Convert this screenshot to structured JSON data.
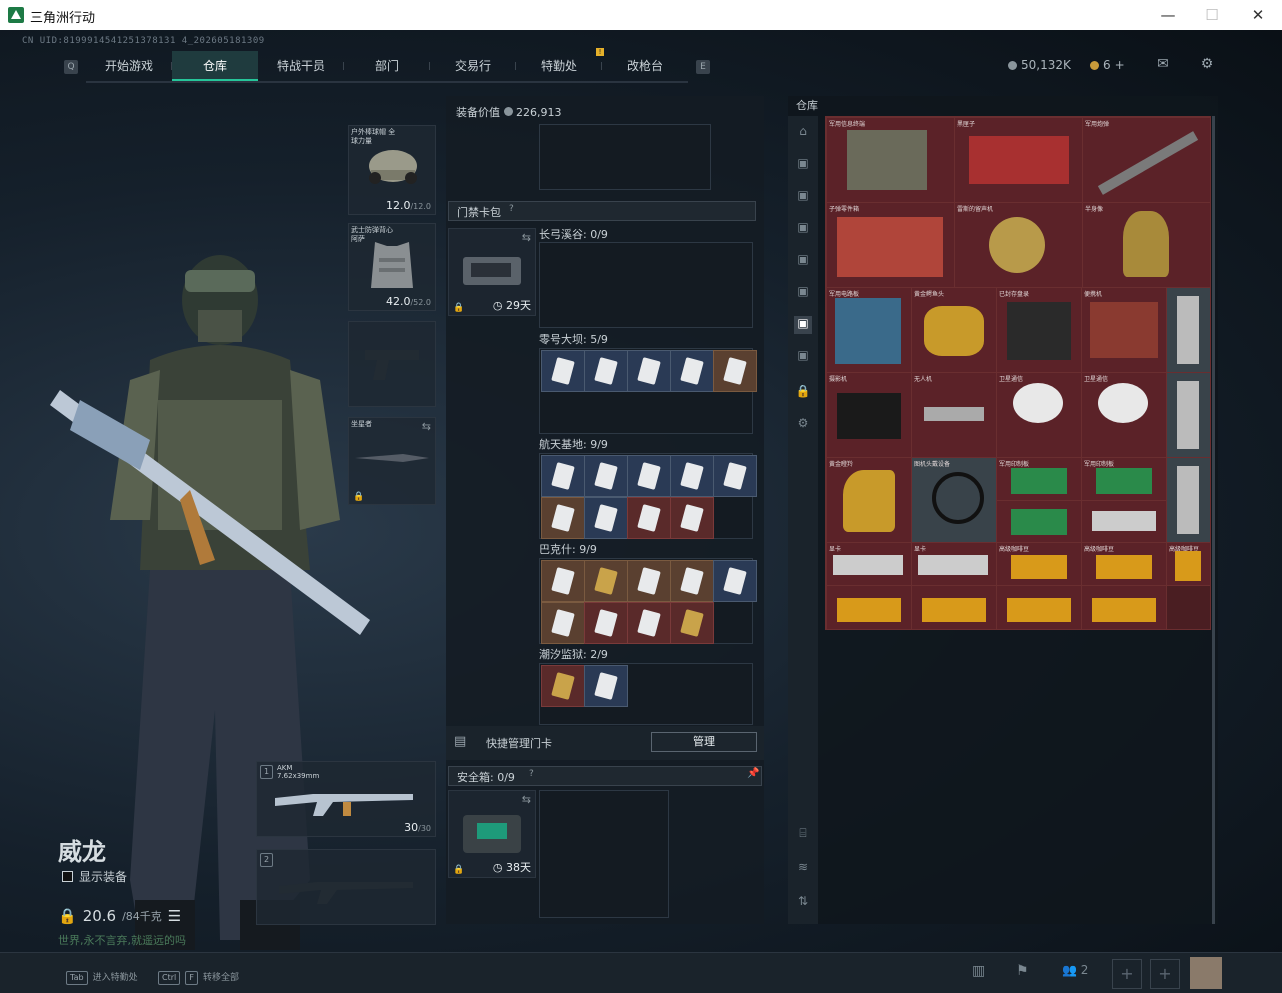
{
  "window": {
    "title": "三角洲行动",
    "minimize": "—",
    "maximize": "☐",
    "close": "✕"
  },
  "uid": "CN UID:8199914541251378131 4_202605181309",
  "nav": {
    "tabs": [
      "开始游戏",
      "仓库",
      "特战干员",
      "部门",
      "交易行",
      "特勤处",
      "改枪台"
    ],
    "active_tab": "仓库",
    "left_key": "Q",
    "right_key": "E",
    "badge": "!"
  },
  "currency": {
    "coins": "50,132K",
    "gold": "6",
    "add": "+"
  },
  "character": {
    "name": "威龙",
    "show_equipment": "显示装备",
    "weight": "20.6",
    "weight_max": "/84千克",
    "motto": "世界,永不言弃,就遥远的吗"
  },
  "slots": {
    "helmet": {
      "name": "户外棒球帽 全球力量",
      "value": "12.0",
      "max": "/12.0"
    },
    "armor": {
      "name": "武士防弹背心 阿萨",
      "value": "42.0",
      "max": "/52.0"
    },
    "melee": {
      "name": "坐星者"
    },
    "weapon1": {
      "index": "1",
      "name": "AKM",
      "caliber": "7.62x39mm",
      "ammo": "30",
      "ammo_max": "/30"
    },
    "weapon2": {
      "index": "2"
    }
  },
  "equipment": {
    "value_label": "装备价值",
    "value": "226,913",
    "keycard_bag": "门禁卡包",
    "help": "?",
    "bag_days": "29天",
    "maps": [
      {
        "name": "长弓溪谷",
        "count": "0/9"
      },
      {
        "name": "零号大坝",
        "count": "5/9"
      },
      {
        "name": "航天基地",
        "count": "9/9"
      },
      {
        "name": "巴克什",
        "count": "9/9"
      },
      {
        "name": "潮汐监狱",
        "count": "2/9"
      }
    ],
    "quick_manage": "快捷管理门卡",
    "manage_button": "管理",
    "safe_box": "安全箱",
    "safe_count": "0/9",
    "safe_days": "38天"
  },
  "warehouse": {
    "title": "仓库",
    "items": [
      "军用信息终端",
      "黑匣子",
      "军用炮弹",
      "子弹零件箱",
      "雷斯的留声机",
      "半身像",
      "军用电路板",
      "黄金鳄鱼头",
      "已封存盘录",
      "便携机",
      "摄影机",
      "无人机",
      "卫星通信",
      "卫星通信",
      "黄金瞪羚",
      "图机头戴设备",
      "军用印制板",
      "军用印制板",
      "显卡",
      "显卡",
      "高级咖啡豆",
      "高级咖啡豆",
      "高级咖啡豆"
    ]
  },
  "footer": {
    "tab_key": "Tab",
    "tab_action": "进入特勤处",
    "ctrl_key": "Ctrl",
    "f_key": "F",
    "f_action": "转移全部",
    "squad": "2"
  }
}
